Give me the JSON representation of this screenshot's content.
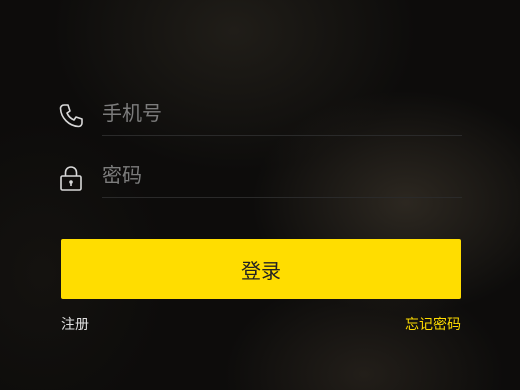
{
  "form": {
    "phone": {
      "value": "",
      "placeholder": "手机号",
      "icon": "phone-icon"
    },
    "password": {
      "value": "",
      "placeholder": "密码",
      "icon": "lock-icon"
    },
    "login_label": "登录",
    "register_label": "注册",
    "forgot_label": "忘记密码"
  },
  "colors": {
    "accent": "#ffdd00",
    "background": "#0d0c0b",
    "placeholder": "#7c7c7c",
    "link": "#e0e0e0"
  }
}
